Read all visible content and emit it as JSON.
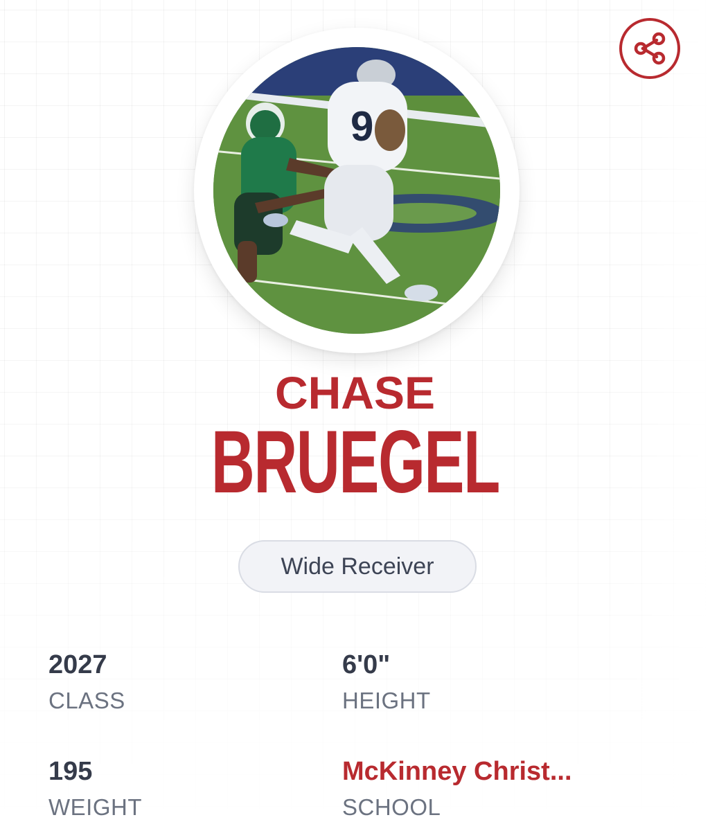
{
  "share": {
    "icon": "share-icon"
  },
  "player": {
    "first_name": "CHASE",
    "last_name": "BRUEGEL",
    "position": "Wide Receiver",
    "photo": {
      "description_icon": "player-photo",
      "jersey_number": "9"
    }
  },
  "stats": [
    {
      "value": "2027",
      "label": "CLASS"
    },
    {
      "value": "6'0\"",
      "label": "HEIGHT"
    },
    {
      "value": "195",
      "label": "WEIGHT"
    },
    {
      "value": "McKinney Christ...",
      "label": "SCHOOL"
    }
  ],
  "colors": {
    "accent": "#b82a2f",
    "text_dark": "#353b4a",
    "text_muted": "#6b7280",
    "pill_bg": "#f2f3f7",
    "pill_border": "#d9dce4"
  }
}
